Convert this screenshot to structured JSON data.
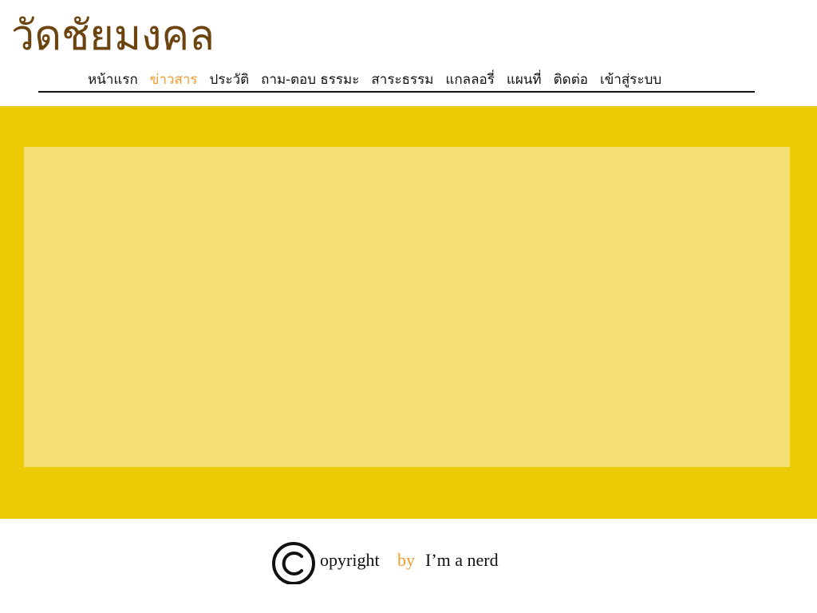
{
  "site": {
    "title": "วัดชัยมงคล"
  },
  "nav": {
    "items": [
      {
        "label": "หน้าแรก",
        "active": false
      },
      {
        "label": "ข่าวสาร",
        "active": true
      },
      {
        "label": "ประวัติ",
        "active": false
      },
      {
        "label": "ถาม-ตอบ ธรรมะ",
        "active": false
      },
      {
        "label": "สาระธรรม",
        "active": false
      },
      {
        "label": "แกลลอรี่",
        "active": false
      },
      {
        "label": "แผนที่",
        "active": false
      },
      {
        "label": "ติดต่อ",
        "active": false
      },
      {
        "label": "เข้าสู่ระบบ",
        "active": false
      }
    ]
  },
  "footer": {
    "copyright_icon": "copyright-icon",
    "copyright_text": "opyright",
    "by_text": "by",
    "author": "I’m a nerd"
  },
  "colors": {
    "title": "#6b4410",
    "accent": "#f29a2e",
    "band": "#ebcb05",
    "panel": "#f5df72"
  }
}
